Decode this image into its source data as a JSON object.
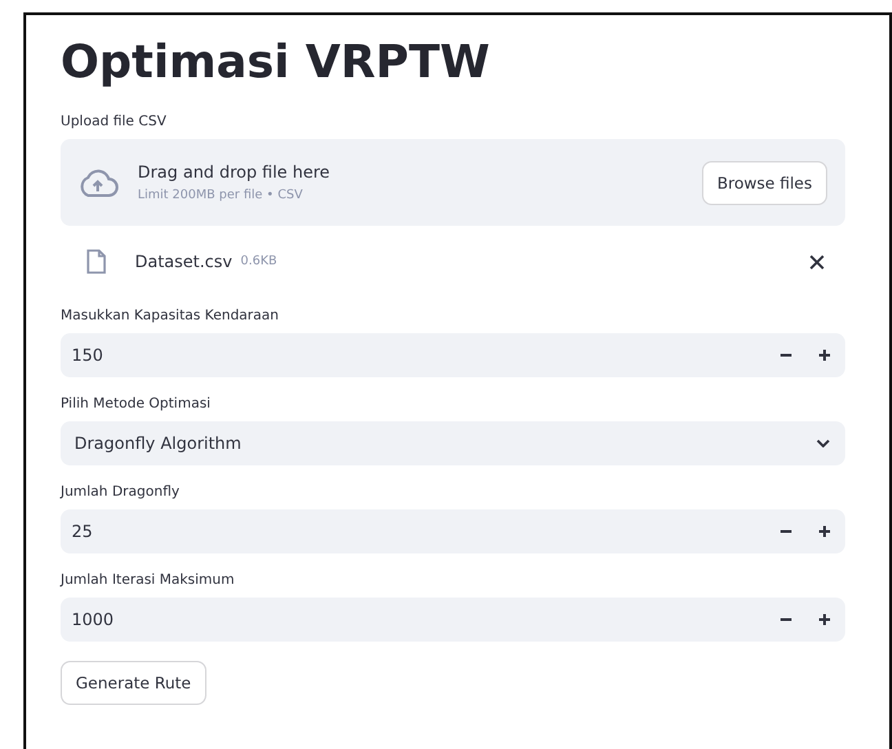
{
  "title": "Optimasi VRPTW",
  "uploader": {
    "label": "Upload file CSV",
    "dropzone_title": "Drag and drop file here",
    "dropzone_hint": "Limit 200MB per file • CSV",
    "browse_button": "Browse files"
  },
  "file": {
    "name": "Dataset.csv",
    "size": "0.6KB"
  },
  "fields": [
    {
      "kind": "number",
      "label": "Masukkan Kapasitas Kendaraan",
      "value": "150"
    },
    {
      "kind": "select",
      "label": "Pilih Metode Optimasi",
      "value": "Dragonfly Algorithm"
    },
    {
      "kind": "number",
      "label": "Jumlah Dragonfly",
      "value": "25"
    },
    {
      "kind": "number",
      "label": "Jumlah Iterasi Maksimum",
      "value": "1000"
    }
  ],
  "button": "Generate Rute"
}
